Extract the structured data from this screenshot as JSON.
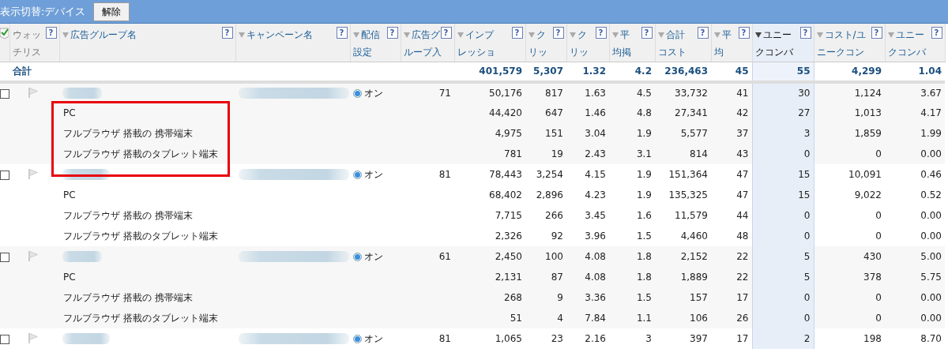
{
  "toolbar": {
    "label": "表示切替:デバイス",
    "button": "解除"
  },
  "header_checkbox": {
    "checked": true
  },
  "columns": [
    {
      "lines": [
        "ウォッ",
        "チリス"
      ],
      "help": "?",
      "sortable": false,
      "sorted": false
    },
    {
      "lines": [
        "広告グループ名"
      ],
      "help": "?",
      "sortable": true,
      "sorted": false
    },
    {
      "lines": [
        "キャンペーン名"
      ],
      "help": "?",
      "sortable": true,
      "sorted": false
    },
    {
      "lines": [
        "配信",
        "設定"
      ],
      "help": "?",
      "sortable": true,
      "sorted": false
    },
    {
      "lines": [
        "広告グ",
        "ループ入"
      ],
      "help": "?",
      "sortable": true,
      "sorted": false
    },
    {
      "lines": [
        "インプ",
        "レッショ"
      ],
      "help": "?",
      "sortable": true,
      "sorted": false
    },
    {
      "lines": [
        "ク",
        "リッ"
      ],
      "help": "?",
      "sortable": true,
      "sorted": false
    },
    {
      "lines": [
        "ク",
        "リッ"
      ],
      "help": "?",
      "sortable": true,
      "sorted": false
    },
    {
      "lines": [
        "平",
        "均掲"
      ],
      "help": "?",
      "sortable": true,
      "sorted": false
    },
    {
      "lines": [
        "合計",
        "コスト"
      ],
      "help": "?",
      "sortable": true,
      "sorted": false
    },
    {
      "lines": [
        "平",
        "均"
      ],
      "help": "?",
      "sortable": true,
      "sorted": false
    },
    {
      "lines": [
        "ユニー",
        "クコンバ"
      ],
      "help": "?",
      "sortable": true,
      "sorted": true
    },
    {
      "lines": [
        "コスト/ユ",
        "ニークコン"
      ],
      "help": "?",
      "sortable": true,
      "sorted": false
    },
    {
      "lines": [
        "ユニー",
        "クコンバ"
      ],
      "help": "?",
      "sortable": true,
      "sorted": false
    }
  ],
  "total": {
    "label": "合計",
    "values": [
      "401,579",
      "5,307",
      "1.32",
      "4.2",
      "236,463",
      "45",
      "55",
      "4,299",
      "1.04"
    ]
  },
  "groups": [
    {
      "checked": false,
      "status_on": true,
      "status": "オン",
      "bid": "71",
      "highlighted": true,
      "values": [
        "50,176",
        "817",
        "1.63",
        "4.5",
        "33,732",
        "41",
        "30",
        "1,124",
        "3.67"
      ],
      "children": [
        {
          "device": "PC",
          "values": [
            "44,420",
            "647",
            "1.46",
            "4.8",
            "27,341",
            "42",
            "27",
            "1,013",
            "4.17"
          ]
        },
        {
          "device": "フルブラウザ 搭載の 携帯端末",
          "values": [
            "4,975",
            "151",
            "3.04",
            "1.9",
            "5,577",
            "37",
            "3",
            "1,859",
            "1.99"
          ]
        },
        {
          "device": "フルブラウザ 搭載のタブレット端末",
          "values": [
            "781",
            "19",
            "2.43",
            "3.1",
            "814",
            "43",
            "0",
            "0",
            "0.00"
          ]
        }
      ]
    },
    {
      "checked": false,
      "status_on": true,
      "status": "オン",
      "bid": "81",
      "values": [
        "78,443",
        "3,254",
        "4.15",
        "1.9",
        "151,364",
        "47",
        "15",
        "10,091",
        "0.46"
      ],
      "children": [
        {
          "device": "PC",
          "values": [
            "68,402",
            "2,896",
            "4.23",
            "1.9",
            "135,325",
            "47",
            "15",
            "9,022",
            "0.52"
          ]
        },
        {
          "device": "フルブラウザ 搭載の 携帯端末",
          "values": [
            "7,715",
            "266",
            "3.45",
            "1.6",
            "11,579",
            "44",
            "0",
            "0",
            "0.00"
          ]
        },
        {
          "device": "フルブラウザ 搭載のタブレット端末",
          "values": [
            "2,326",
            "92",
            "3.96",
            "1.5",
            "4,460",
            "48",
            "0",
            "0",
            "0.00"
          ]
        }
      ]
    },
    {
      "checked": false,
      "status_on": true,
      "status": "オン",
      "bid": "61",
      "values": [
        "2,450",
        "100",
        "4.08",
        "1.8",
        "2,152",
        "22",
        "5",
        "430",
        "5.00"
      ],
      "children": [
        {
          "device": "PC",
          "values": [
            "2,131",
            "87",
            "4.08",
            "1.8",
            "1,889",
            "22",
            "5",
            "378",
            "5.75"
          ]
        },
        {
          "device": "フルブラウザ 搭載の 携帯端末",
          "values": [
            "268",
            "9",
            "3.36",
            "1.5",
            "157",
            "17",
            "0",
            "0",
            "0.00"
          ]
        },
        {
          "device": "フルブラウザ 搭載のタブレット端末",
          "values": [
            "51",
            "4",
            "7.84",
            "1.1",
            "106",
            "26",
            "0",
            "0",
            "0.00"
          ]
        }
      ]
    },
    {
      "checked": false,
      "status_on": true,
      "status": "オン",
      "bid": "81",
      "values": [
        "1,065",
        "23",
        "2.16",
        "3",
        "397",
        "17",
        "2",
        "198",
        "8.70"
      ]
    }
  ]
}
